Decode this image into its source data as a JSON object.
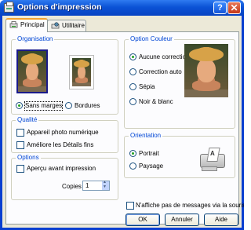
{
  "window": {
    "title": "Options d'impression",
    "help_label": "?",
    "close_label": "✕"
  },
  "tabs": [
    {
      "label": "Principal",
      "active": true
    },
    {
      "label": "Utilitaire",
      "active": false
    }
  ],
  "organisation": {
    "title": "Organisation",
    "options": [
      {
        "label": "Sans marges",
        "selected": true
      },
      {
        "label": "Bordures",
        "selected": false
      }
    ]
  },
  "color_option": {
    "title": "Option Couleur",
    "options": [
      {
        "label": "Aucune correction",
        "selected": true
      },
      {
        "label": "Correction auto",
        "selected": false
      },
      {
        "label": "Sépia",
        "selected": false
      },
      {
        "label": "Noir & blanc",
        "selected": false
      }
    ]
  },
  "quality": {
    "title": "Qualité",
    "options": [
      {
        "label": "Appareil photo numérique",
        "checked": false
      },
      {
        "label": "Améliore les Détails fins",
        "checked": false
      }
    ]
  },
  "orientation": {
    "title": "Orientation",
    "options": [
      {
        "label": "Portrait",
        "selected": true
      },
      {
        "label": "Paysage",
        "selected": false
      }
    ]
  },
  "options": {
    "title": "Options",
    "preview_label": "Aperçu avant impression",
    "preview_checked": false,
    "copies_label": "Copies",
    "copies_value": "1"
  },
  "footer": {
    "no_mouse_messages_label": "N'affiche pas de messages via la souris.",
    "no_mouse_messages_checked": false,
    "ok_label": "OK",
    "cancel_label": "Annuler",
    "help_label": "Aide"
  },
  "colors": {
    "titlebar": "#0b53d6",
    "group_title": "#0046d5",
    "dialog_bg": "#ece9d8",
    "panel_bg": "#fcfcfe"
  }
}
